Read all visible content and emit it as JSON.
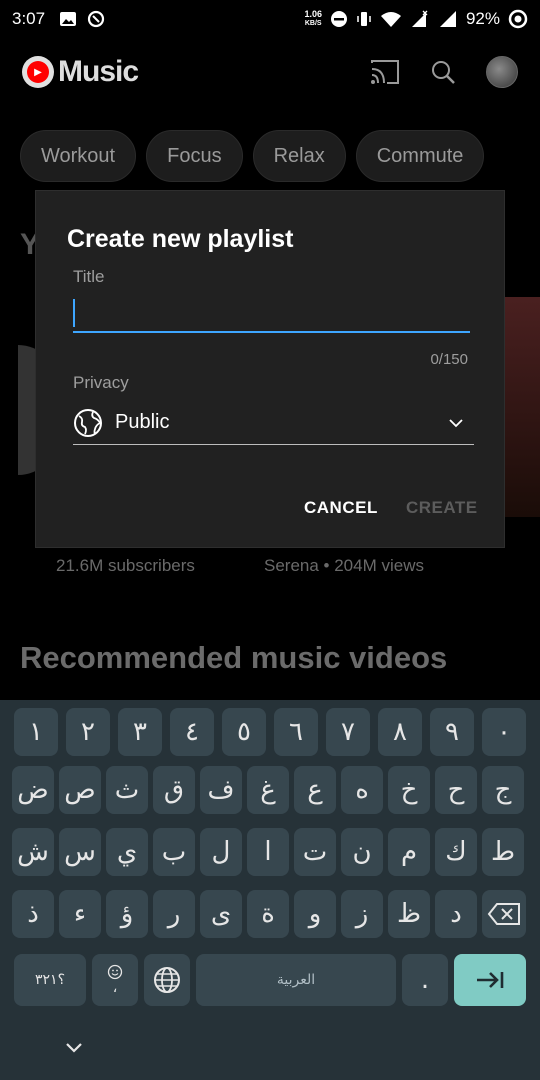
{
  "status_bar": {
    "time": "3:07",
    "net_speed_value": "1.06",
    "net_speed_unit": "KB/S",
    "battery": "92%"
  },
  "app": {
    "name": "Music",
    "icons": [
      "cast-icon",
      "search-icon",
      "account-avatar"
    ]
  },
  "chips": [
    "Workout",
    "Focus",
    "Relax",
    "Commute"
  ],
  "background": {
    "section_initial": "Y",
    "subscribers": "21.6M subscribers",
    "video_meta": "Serena • 204M views",
    "recommended_title": "Recommended music videos"
  },
  "dialog": {
    "title": "Create new playlist",
    "title_label": "Title",
    "title_value": "",
    "title_counter": "0/150",
    "privacy_label": "Privacy",
    "privacy_value": "Public",
    "cancel_label": "CANCEL",
    "create_label": "CREATE"
  },
  "keyboard": {
    "row1": [
      "١",
      "٢",
      "٣",
      "٤",
      "٥",
      "٦",
      "٧",
      "٨",
      "٩",
      "٠"
    ],
    "row2": [
      "ض",
      "ص",
      "ث",
      "ق",
      "ف",
      "غ",
      "ع",
      "ه",
      "خ",
      "ح",
      "ج"
    ],
    "row3": [
      "ش",
      "س",
      "ي",
      "ب",
      "ل",
      "ا",
      "ت",
      "ن",
      "م",
      "ك",
      "ط"
    ],
    "row4": [
      "ذ",
      "ء",
      "ؤ",
      "ر",
      "ى",
      "ة",
      "و",
      "ز",
      "ظ",
      "د"
    ],
    "symbols_key": "؟٣٢١",
    "comma_key": "،",
    "space_label": "العربية",
    "period_key": "."
  },
  "colors": {
    "accent_blue": "#3ea6ff",
    "keyboard_bg": "#263238",
    "key_bg": "#37474f",
    "enter_key": "#80cbc4",
    "youtube_red": "#ff0000"
  }
}
